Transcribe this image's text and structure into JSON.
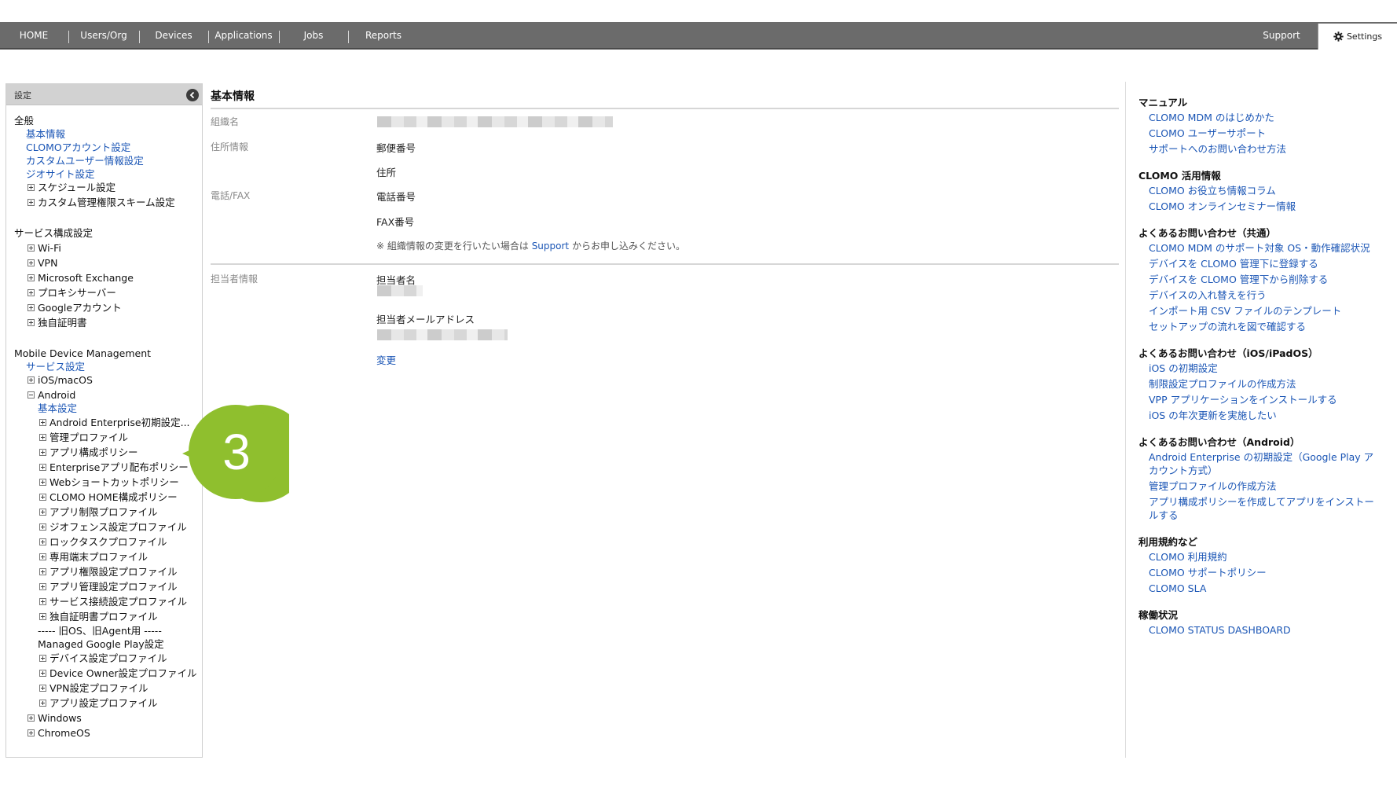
{
  "nav": {
    "home": "HOME",
    "users": "Users/Org",
    "devices": "Devices",
    "applications": "Applications",
    "jobs": "Jobs",
    "reports": "Reports",
    "support": "Support",
    "settings": "Settings"
  },
  "sidebar": {
    "header": "設定",
    "general": {
      "heading": "全般",
      "basic_info": "基本情報",
      "clomo_account": "CLOMOアカウント設定",
      "custom_user": "カスタムユーザー情報設定",
      "geosite": "ジオサイト設定",
      "schedule": "スケジュール設定",
      "custom_admin": "カスタム管理権限スキーム設定"
    },
    "service": {
      "heading": "サービス構成設定",
      "wifi": "Wi-Fi",
      "vpn": "VPN",
      "exchange": "Microsoft Exchange",
      "proxy": "プロキシサーバー",
      "google": "Googleアカウント",
      "cert": "独自証明書"
    },
    "mdm": {
      "heading": "Mobile Device Management",
      "service_settings": "サービス設定",
      "ios": "iOS/macOS",
      "android": "Android",
      "android_basic": "基本設定",
      "ae_initial": "Android Enterprise初期設定...",
      "mgmt_profile": "管理プロファイル",
      "app_config": "アプリ構成ポリシー",
      "ent_app": "Enterpriseアプリ配布ポリシー",
      "web_shortcut": "Webショートカットポリシー",
      "clomo_home": "CLOMO HOME構成ポリシー",
      "app_restrict": "アプリ制限プロファイル",
      "geofence": "ジオフェンス設定プロファイル",
      "lock_task": "ロックタスクプロファイル",
      "dedicated": "専用端末プロファイル",
      "app_perm": "アプリ権限設定プロファイル",
      "app_mgmt": "アプリ管理設定プロファイル",
      "svc_conn": "サービス接続設定プロファイル",
      "own_cert": "独自証明書プロファイル",
      "legacy_sep": "----- 旧OS、旧Agent用 -----",
      "mgp_settings": "Managed Google Play設定",
      "device_settings": "デバイス設定プロファイル",
      "device_owner": "Device Owner設定プロファイル",
      "vpn_profile": "VPN設定プロファイル",
      "app_settings": "アプリ設定プロファイル",
      "windows": "Windows",
      "chromeos": "ChromeOS"
    }
  },
  "main": {
    "title": "基本情報",
    "org_name_label": "組織名",
    "address_label": "住所情報",
    "postal": "郵便番号",
    "address": "住所",
    "phone_label": "電話/FAX",
    "phone": "電話番号",
    "fax": "FAX番号",
    "note_prefix": "※ 組織情報の変更を行いたい場合は ",
    "note_link": "Support",
    "note_suffix": " からお申し込みください。",
    "contact_label": "担当者情報",
    "contact_name": "担当者名",
    "contact_email": "担当者メールアドレス",
    "change": "変更"
  },
  "right": {
    "manual": {
      "heading": "マニュアル",
      "l1": "CLOMO MDM のはじめかた",
      "l2": "CLOMO ユーザーサポート",
      "l3": "サポートへのお問い合わせ方法"
    },
    "utilization": {
      "heading": "CLOMO 活用情報",
      "l1": "CLOMO お役立ち情報コラム",
      "l2": "CLOMO オンラインセミナー情報"
    },
    "faq_common": {
      "heading": "よくあるお問い合わせ（共通）",
      "l1": "CLOMO MDM のサポート対象 OS・動作確認状況",
      "l2": "デバイスを CLOMO 管理下に登録する",
      "l3": "デバイスを CLOMO 管理下から削除する",
      "l4": "デバイスの入れ替えを行う",
      "l5": "インポート用 CSV ファイルのテンプレート",
      "l6": "セットアップの流れを図で確認する"
    },
    "faq_ios": {
      "heading": "よくあるお問い合わせ（iOS/iPadOS）",
      "l1": "iOS の初期設定",
      "l2": "制限設定プロファイルの作成方法",
      "l3": "VPP アプリケーションをインストールする",
      "l4": "iOS の年次更新を実施したい"
    },
    "faq_android": {
      "heading": "よくあるお問い合わせ（Android）",
      "l1": "Android Enterprise の初期設定（Google Play アカウント方式）",
      "l2": "管理プロファイルの作成方法",
      "l3": "アプリ構成ポリシーを作成してアプリをインストールする"
    },
    "terms": {
      "heading": "利用規約など",
      "l1": "CLOMO 利用規約",
      "l2": "CLOMO サポートポリシー",
      "l3": "CLOMO SLA"
    },
    "status": {
      "heading": "稼働状況",
      "l1": "CLOMO STATUS DASHBOARD"
    }
  },
  "callout": {
    "number": "3",
    "color": "#8fbf2e"
  }
}
